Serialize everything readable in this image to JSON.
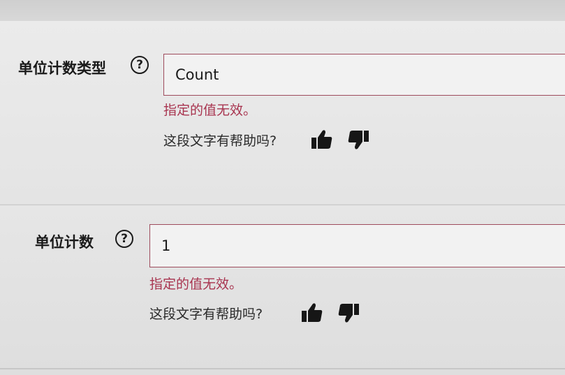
{
  "fields": [
    {
      "label": "单位计数类型",
      "value": "Count",
      "error": "指定的值无效。",
      "feedback_prompt": "这段文字有帮助吗?"
    },
    {
      "label": "单位计数",
      "value": "1",
      "error": "指定的值无效。",
      "feedback_prompt": "这段文字有帮助吗?"
    }
  ],
  "help_glyph": "?",
  "icons": {
    "help": "question-circle-icon",
    "helpful": "thumbs-up-icon",
    "not_helpful": "thumbs-down-icon"
  },
  "colors": {
    "error": "#a8344f",
    "field_border": "#9e4b5c"
  }
}
